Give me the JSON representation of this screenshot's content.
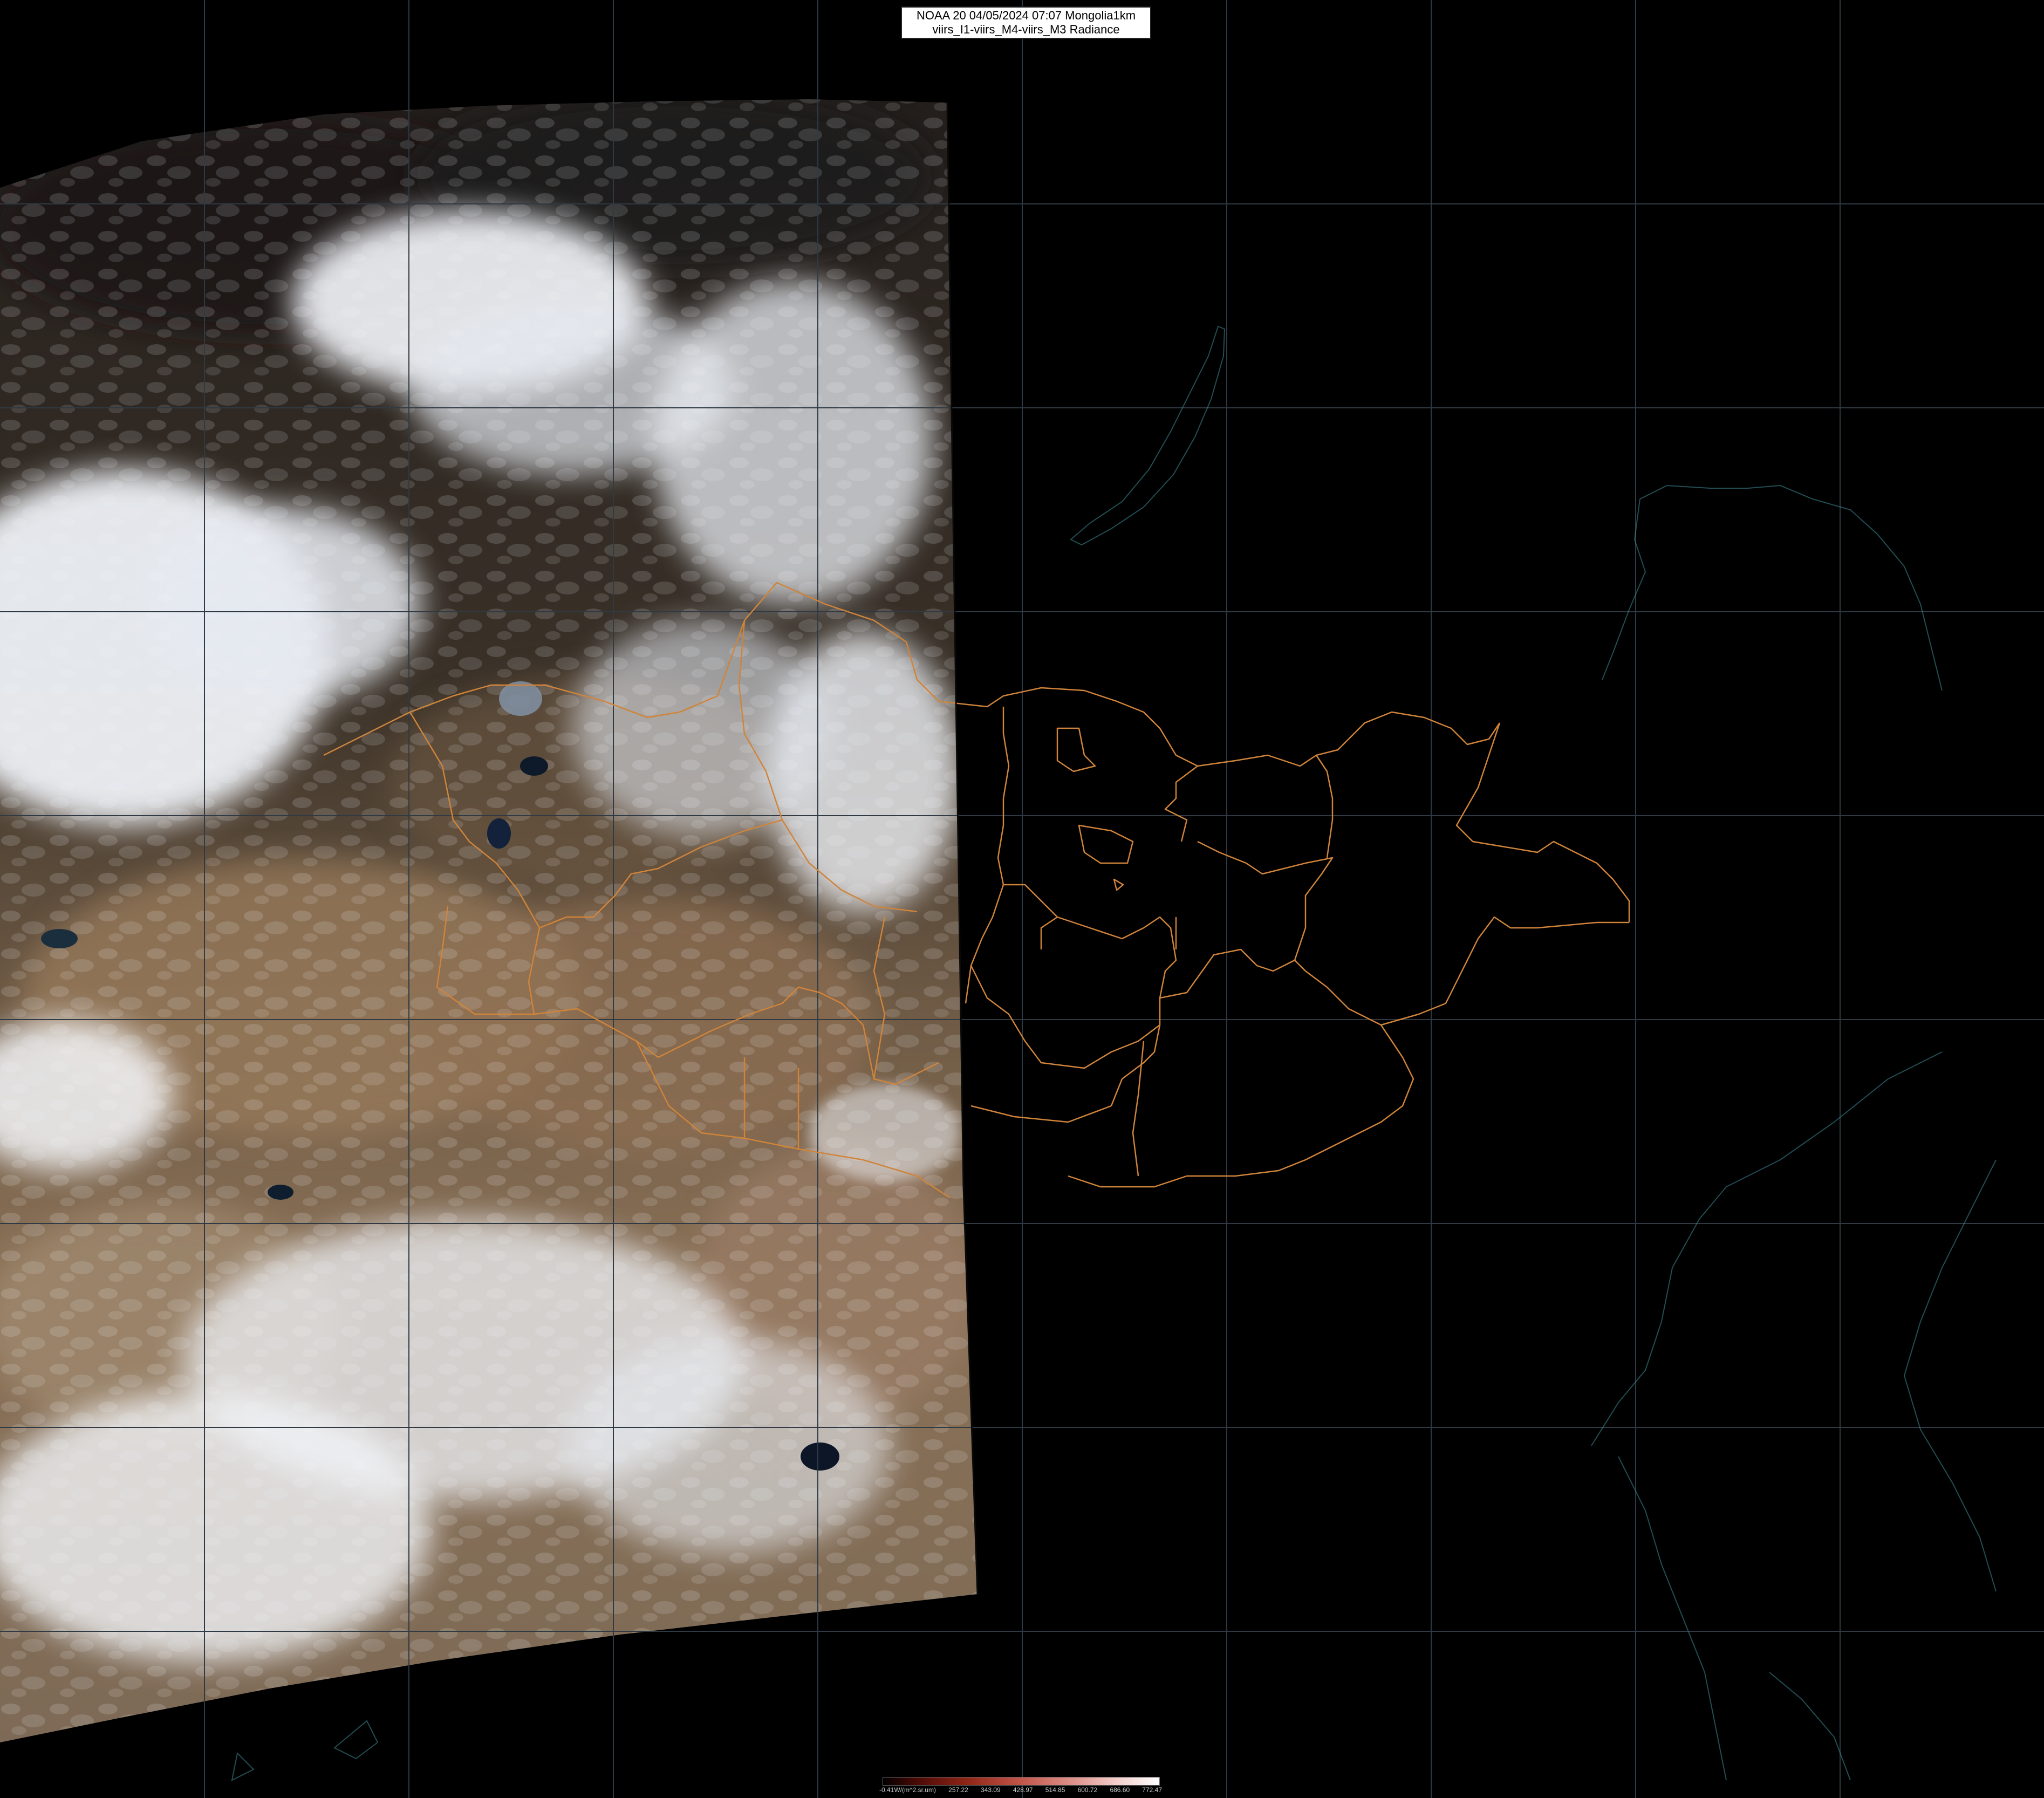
{
  "title": {
    "line1": "NOAA 20 04/05/2024 07:07 Mongolia1km",
    "line2": "viirs_I1-viirs_M4-viirs_M3 Radiance"
  },
  "legend": {
    "ticks": [
      "-0.41W/(m^2.sr.um)",
      "257.22",
      "343.09",
      "428.97",
      "514.85",
      "600.72",
      "686.60",
      "772.47"
    ]
  },
  "colors": {
    "background": "#000000",
    "graticule": "#2f3a44",
    "admin_boundary": "#d0843a",
    "coastline": "#3c8e99",
    "cloud": "#eef1f6",
    "land_dark": "#2b2622",
    "desert": "#8a7157"
  },
  "layers": [
    "satellite-swath",
    "cloud-cover",
    "admin-boundaries",
    "coastline",
    "graticule"
  ]
}
